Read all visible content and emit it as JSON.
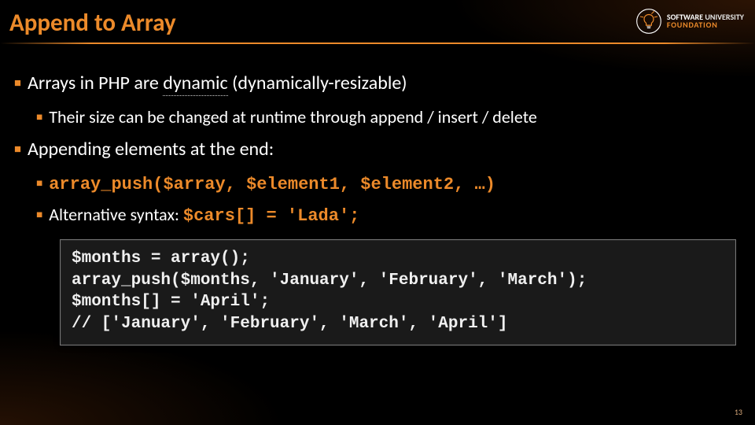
{
  "title": "Append to Array",
  "logo": {
    "line1": "SOFTWARE",
    "line2": "UNIVERSITY",
    "line3": "FOUNDATION"
  },
  "bullets": {
    "dynamic_pre": "Arrays in PHP are ",
    "dynamic_word": "dynamic",
    "dynamic_post": " (dynamically-resizable)",
    "size_line": "Their size can be changed at runtime through append / insert / delete",
    "append_line": "Appending elements at the end:",
    "push_code": "array_push($array, $element1, $element2, …)",
    "alt_pre": "Alternative syntax: ",
    "alt_code": "$cars[] = 'Lada';"
  },
  "code": "$months = array();\narray_push($months, 'January', 'February', 'March');\n$months[] = 'April';\n// ['January', 'February', 'March', 'April']",
  "page_number": "13"
}
